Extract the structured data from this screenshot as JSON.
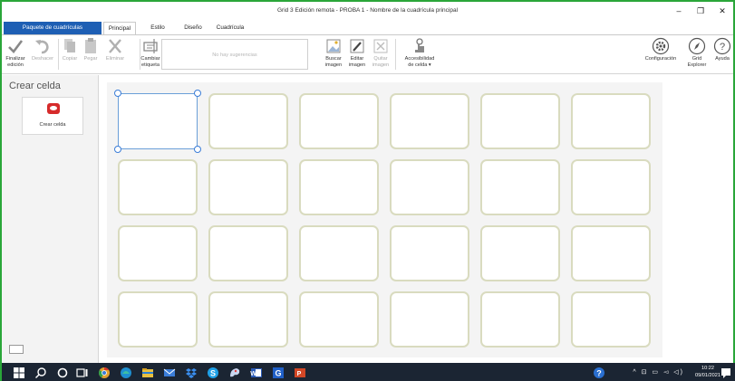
{
  "window": {
    "title": "Grid 3 Edición remota - PROBA 1 - Nombre de la cuadrícula principal",
    "minimize": "–",
    "restore": "❐",
    "close": "✕"
  },
  "tabs": [
    {
      "label": "Paquete de cuadrículas"
    },
    {
      "label": "Principal"
    },
    {
      "label": "Estilo"
    },
    {
      "label": "Diseño"
    },
    {
      "label": "Cuadrícula"
    }
  ],
  "ribbon": {
    "finalize": {
      "line1": "Finalizar",
      "line2": "edición"
    },
    "undo": "Deshacer",
    "copy": "Copiar",
    "paste": "Pegar",
    "delete": "Eliminar",
    "change_label": {
      "line1": "Cambiar",
      "line2": "etiqueta"
    },
    "suggestions": "No hay sugerencias",
    "search_image": {
      "line1": "Buscar",
      "line2": "imagen"
    },
    "edit_image": {
      "line1": "Editar",
      "line2": "imagen"
    },
    "remove_image": {
      "line1": "Quitar",
      "line2": "imagen"
    },
    "accessibility": {
      "line1": "Accesibilidad",
      "line2": "de celda ▾"
    },
    "settings": "Configuración",
    "explorer": {
      "line1": "Grid",
      "line2": "Explorer"
    },
    "help": "Ayuda"
  },
  "left_panel": {
    "title": "Crear celda",
    "tile_label": "Crear celda"
  },
  "grid": {
    "rows": 4,
    "cols": 6,
    "selected_cell": [
      0,
      0
    ]
  },
  "taskbar": {
    "time": "10:22",
    "date": "09/01/2021",
    "tray": "^ ⊡ ▭ ◅ ◁)"
  },
  "colors": {
    "accent_green": "#2aa639",
    "tab_blue": "#1e5fb4",
    "cell_border": "#d9dbbf",
    "selection": "#3b7dd8",
    "taskbar": "#1b2533"
  }
}
